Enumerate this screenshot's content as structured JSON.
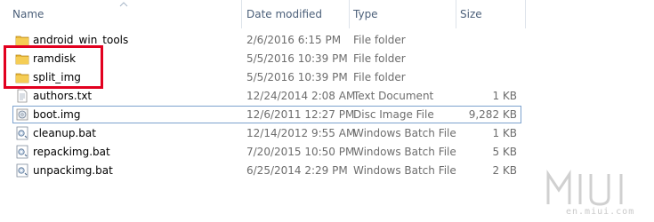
{
  "columns": {
    "name": "Name",
    "date": "Date modified",
    "type": "Type",
    "size": "Size"
  },
  "files": [
    {
      "name": "android_win_tools",
      "date": "2/6/2016 6:15 PM",
      "type": "File folder",
      "size": "",
      "icon": "folder-icon"
    },
    {
      "name": "ramdisk",
      "date": "5/5/2016 10:39 PM",
      "type": "File folder",
      "size": "",
      "icon": "folder-icon"
    },
    {
      "name": "split_img",
      "date": "5/5/2016 10:39 PM",
      "type": "File folder",
      "size": "",
      "icon": "folder-icon"
    },
    {
      "name": "authors.txt",
      "date": "12/24/2014 2:08 AM",
      "type": "Text Document",
      "size": "1 KB",
      "icon": "text-file-icon"
    },
    {
      "name": "boot.img",
      "date": "12/6/2011 12:27 PM",
      "type": "Disc Image File",
      "size": "9,282 KB",
      "icon": "disc-image-icon"
    },
    {
      "name": "cleanup.bat",
      "date": "12/14/2012 9:55 AM",
      "type": "Windows Batch File",
      "size": "1 KB",
      "icon": "batch-file-icon"
    },
    {
      "name": "repackimg.bat",
      "date": "7/20/2015 10:50 PM",
      "type": "Windows Batch File",
      "size": "5 KB",
      "icon": "batch-file-icon"
    },
    {
      "name": "unpackimg.bat",
      "date": "6/25/2014 2:29 PM",
      "type": "Windows Batch File",
      "size": "2 KB",
      "icon": "batch-file-icon"
    }
  ],
  "selected_index": 4,
  "watermark": {
    "logo": "MIUI",
    "url": "en.miui.com"
  },
  "colors": {
    "highlight": "#e2001f",
    "folder": "#e8b739",
    "header_text": "#4c607a",
    "selection_border": "#7da2ce"
  }
}
